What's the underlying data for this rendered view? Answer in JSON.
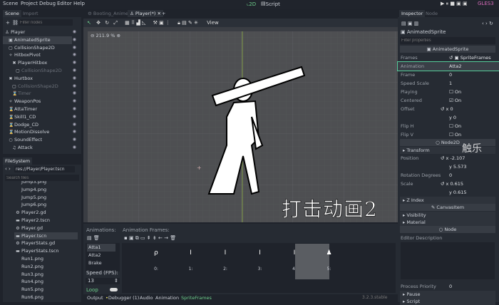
{
  "menu": [
    "Scene",
    "Project",
    "Debug",
    "Editor",
    "Help"
  ],
  "workspace": {
    "tab_2d": "2D",
    "tab_script": "Script",
    "renderer": "GLES3"
  },
  "scene_dock": {
    "tabs": [
      "Scene",
      "Import"
    ],
    "filter_placeholder": "Filter nodes",
    "nodes": [
      {
        "name": "Player",
        "depth": 0,
        "icon": "person-icon"
      },
      {
        "name": "AnimatedSprite",
        "depth": 1,
        "icon": "sprite-icon",
        "selected": true
      },
      {
        "name": "CollisionShape2D",
        "depth": 1,
        "icon": "shape-icon"
      },
      {
        "name": "HitboxPivot",
        "depth": 1,
        "icon": "position-icon"
      },
      {
        "name": "PlayerHitbox",
        "depth": 2,
        "icon": "area-icon"
      },
      {
        "name": "CollisionShape2D",
        "depth": 3,
        "icon": "shape-icon",
        "dim": true
      },
      {
        "name": "Hurtbox",
        "depth": 1,
        "icon": "area-icon"
      },
      {
        "name": "CollisionShape2D",
        "depth": 2,
        "icon": "shape-icon",
        "dim": true
      },
      {
        "name": "Timer",
        "depth": 2,
        "icon": "timer-icon",
        "dim": true
      },
      {
        "name": "WeaponPos",
        "depth": 1,
        "icon": "position-icon"
      },
      {
        "name": "AttaTimer",
        "depth": 1,
        "icon": "timer-icon"
      },
      {
        "name": "Skill1_CD",
        "depth": 1,
        "icon": "timer-icon"
      },
      {
        "name": "Dodge_CD",
        "depth": 1,
        "icon": "timer-icon"
      },
      {
        "name": "MotionDissolve",
        "depth": 1,
        "icon": "timer-icon"
      },
      {
        "name": "SoundEffect",
        "depth": 1,
        "icon": "node-icon"
      },
      {
        "name": "Attack",
        "depth": 2,
        "icon": "audio-icon"
      }
    ]
  },
  "filesystem": {
    "tab": "FileSystem",
    "path": "res://Player/Player.tscn",
    "search_placeholder": "Search files",
    "files": [
      {
        "name": "Jump3.png",
        "icon": "image-icon"
      },
      {
        "name": "Jump4.png",
        "icon": "image-icon"
      },
      {
        "name": "Jump5.png",
        "icon": "image-icon"
      },
      {
        "name": "Jump6.png",
        "icon": "image-icon"
      },
      {
        "name": "Player2.gd",
        "icon": "gear-icon"
      },
      {
        "name": "Player2.tscn",
        "icon": "scene-icon"
      },
      {
        "name": "Player.gd",
        "icon": "gear-icon"
      },
      {
        "name": "Player.tscn",
        "icon": "scene-icon",
        "selected": true
      },
      {
        "name": "PlayerStats.gd",
        "icon": "gear-icon"
      },
      {
        "name": "PlayerStats.tscn",
        "icon": "scene-icon"
      },
      {
        "name": "Run1.png",
        "icon": "image-icon"
      },
      {
        "name": "Run2.png",
        "icon": "image-icon"
      },
      {
        "name": "Run3.png",
        "icon": "image-icon"
      },
      {
        "name": "Run4.png",
        "icon": "image-icon"
      },
      {
        "name": "Run5.png",
        "icon": "image-icon"
      },
      {
        "name": "Run6.png",
        "icon": "image-icon"
      }
    ]
  },
  "editor_tabs": [
    "Booting_Anime",
    "Player(*)"
  ],
  "toolbar": {
    "view": "View"
  },
  "viewport": {
    "zoom": "211.9 %",
    "caption": "打击动画2",
    "watermark": "触乐"
  },
  "sprite_frames": {
    "animations_label": "Animations:",
    "frames_label": "Animation Frames:",
    "animations": [
      "Atta1",
      "Atta2",
      "Brake"
    ],
    "speed_label": "Speed (FPS):",
    "speed": "13",
    "loop_label": "Loop",
    "frames": [
      "0:",
      "1:",
      "2:",
      "3:",
      "4:",
      "5:"
    ],
    "selected_frame": 5
  },
  "bottom_tabs": [
    "Output",
    "Debugger (1)",
    "Audio",
    "Animation",
    "SpriteFrames"
  ],
  "version": "3.2.3.stable",
  "inspector": {
    "tabs": [
      "Inspector",
      "Node"
    ],
    "object": "AnimatedSprite",
    "filter_placeholder": "Filter properties",
    "section_sprite": "AnimatedSprite",
    "frames": {
      "k": "Frames",
      "v": "SpriteFrames"
    },
    "animation": {
      "k": "Animation",
      "v": "Atta2"
    },
    "frame": {
      "k": "Frame",
      "v": "0"
    },
    "speed_scale": {
      "k": "Speed Scale",
      "v": "1"
    },
    "playing": {
      "k": "Playing",
      "v": "On"
    },
    "centered": {
      "k": "Centered",
      "v": "On"
    },
    "offset": {
      "k": "Offset",
      "x": "0",
      "y": "0"
    },
    "flip_h": {
      "k": "Flip H",
      "v": "On"
    },
    "flip_v": {
      "k": "Flip V",
      "v": "On"
    },
    "section_node2d": "Node2D",
    "transform": "Transform",
    "position": {
      "k": "Position",
      "x": "-2.107",
      "y": "5.573"
    },
    "rotation": {
      "k": "Rotation Degrees",
      "v": "0"
    },
    "scale": {
      "k": "Scale",
      "x": "0.615",
      "y": "0.615"
    },
    "z_index": "Z Index",
    "section_canvas": "CanvasItem",
    "visibility": "Visibility",
    "material": "Material",
    "section_node": "Node",
    "editor_description": "Editor Description",
    "process_priority": {
      "k": "Process Priority",
      "v": "0"
    },
    "pause": "Pause",
    "script": "Script"
  },
  "colors": {
    "accent": "#6ecf8c",
    "selection": "#3a3f47",
    "bg": "#262b33"
  }
}
